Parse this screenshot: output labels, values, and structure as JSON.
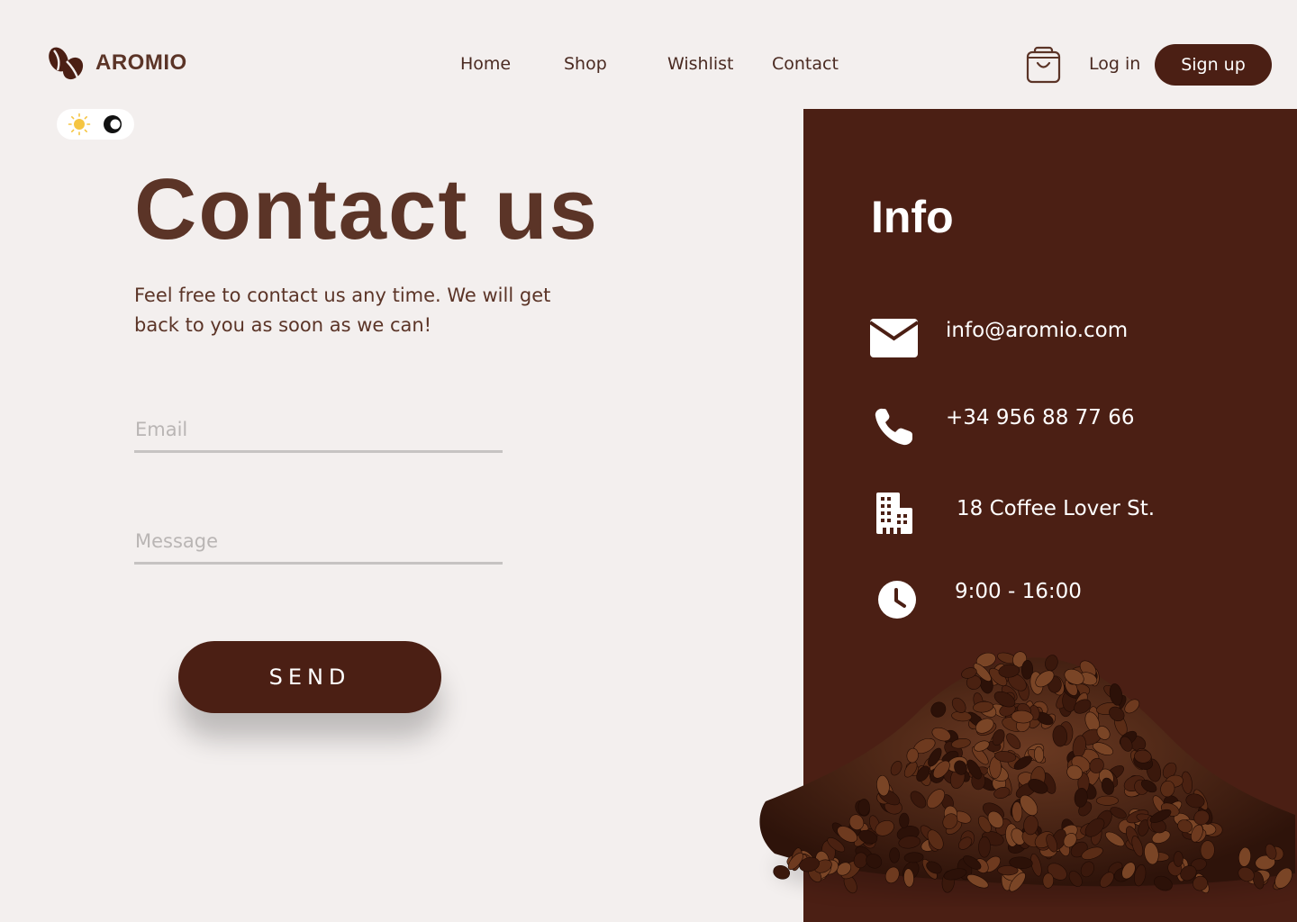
{
  "brand": {
    "name": "AROMIO"
  },
  "nav": {
    "items": [
      {
        "label": "Home"
      },
      {
        "label": "Shop"
      },
      {
        "label": "Wishlist"
      },
      {
        "label": "Contact"
      }
    ],
    "login_label": "Log in",
    "signup_label": "Sign up",
    "cart_icon": "shopping-bag-icon"
  },
  "theme_toggle": {
    "light_icon": "sun-icon",
    "dark_icon": "moon-icon"
  },
  "contact": {
    "title": "Contact us",
    "subtitle": "Feel free to contact us any time. We will get back to you as soon as we can!",
    "email_placeholder": "Email",
    "message_placeholder": "Message",
    "send_label": "SEND"
  },
  "info": {
    "title": "Info",
    "email": "info@aromio.com",
    "phone": "+34 956 88 77 66",
    "address": "18 Coffee Lover St.",
    "hours": "9:00 - 16:00"
  },
  "colors": {
    "background": "#f3efee",
    "brand_dark": "#4b1f14",
    "heading_brown": "#5b3427",
    "input_line": "#c6c3c2",
    "sun": "#f5c542"
  }
}
